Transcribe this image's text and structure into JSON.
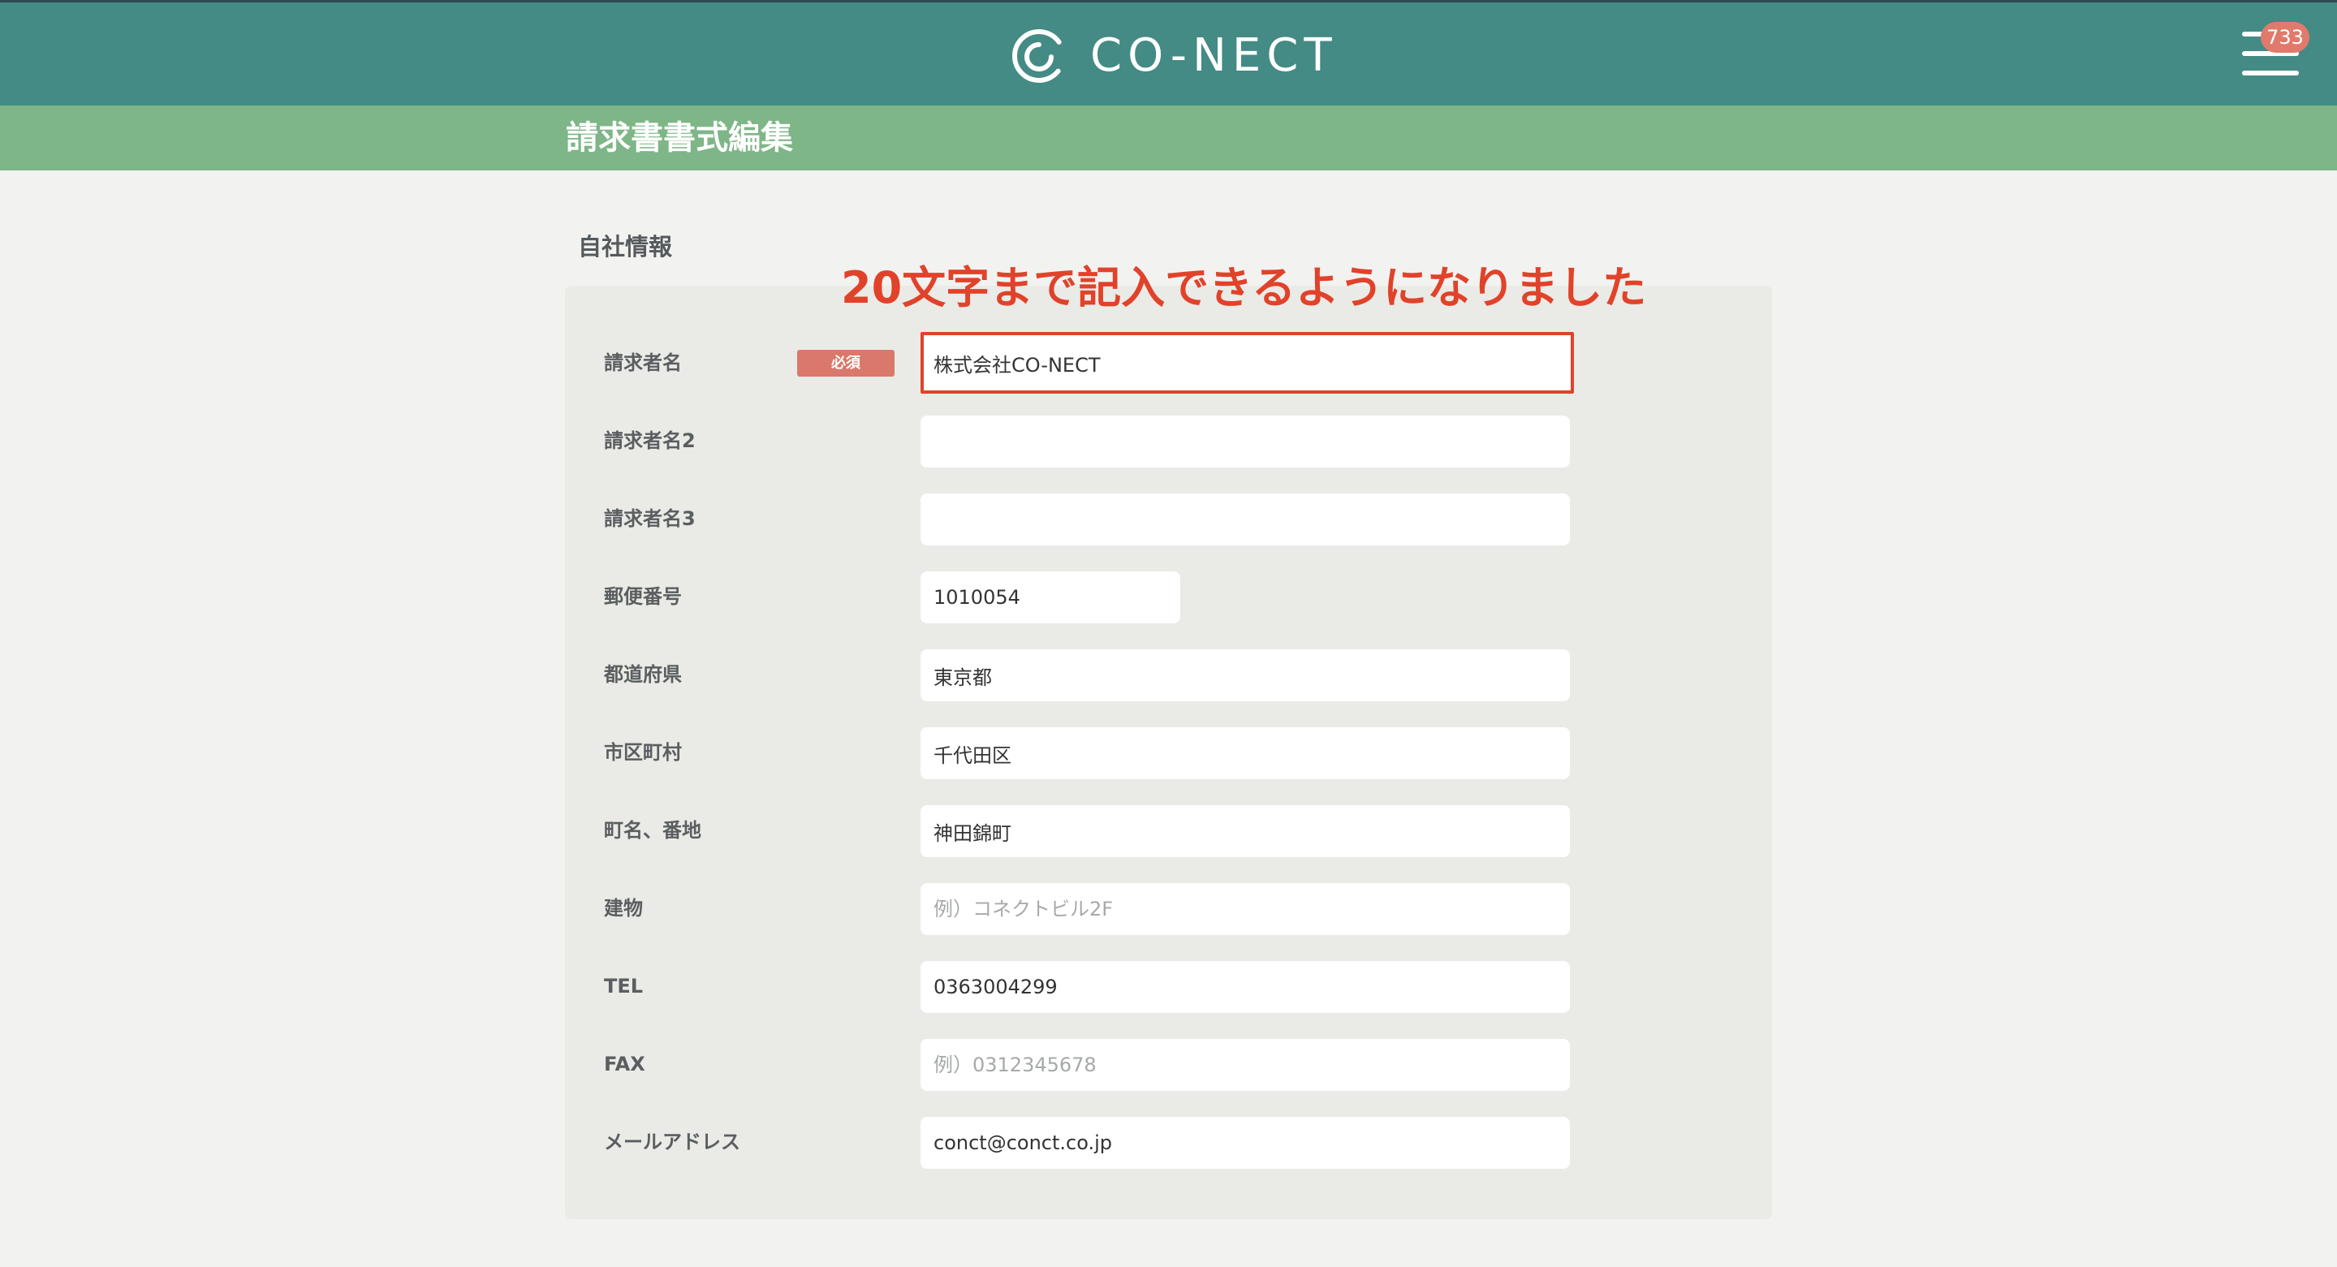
{
  "header": {
    "logo_text": "CO-NECT",
    "notification_count": "733",
    "brand_color": "#438b84",
    "subbar_color": "#7eb687"
  },
  "page": {
    "title": "請求書書式編集"
  },
  "section": {
    "title": "自社情報"
  },
  "annotation": {
    "text": "20文字まで記入できるようになりました",
    "color": "#e1422a"
  },
  "form": {
    "required_badge": "必須",
    "fields": {
      "billing_name": {
        "label": "請求者名",
        "value": "株式会社CO-NECT",
        "placeholder": ""
      },
      "billing_name_2": {
        "label": "請求者名2",
        "value": "",
        "placeholder": ""
      },
      "billing_name_3": {
        "label": "請求者名3",
        "value": "",
        "placeholder": ""
      },
      "postal_code": {
        "label": "郵便番号",
        "value": "1010054",
        "placeholder": ""
      },
      "prefecture": {
        "label": "都道府県",
        "value": "東京都",
        "placeholder": ""
      },
      "city": {
        "label": "市区町村",
        "value": "千代田区",
        "placeholder": ""
      },
      "street": {
        "label": "町名、番地",
        "value": "神田錦町",
        "placeholder": ""
      },
      "building": {
        "label": "建物",
        "value": "",
        "placeholder": "例）コネクトビル2F"
      },
      "tel": {
        "label": "TEL",
        "value": "0363004299",
        "placeholder": ""
      },
      "fax": {
        "label": "FAX",
        "value": "",
        "placeholder": "例）0312345678"
      },
      "email": {
        "label": "メールアドレス",
        "value": "conct@conct.co.jp",
        "placeholder": ""
      }
    }
  },
  "icons": {
    "logo": "conect-logo-icon",
    "menu": "hamburger-menu-icon"
  }
}
